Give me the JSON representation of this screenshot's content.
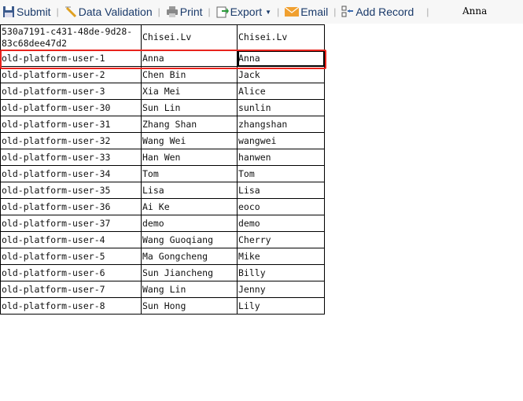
{
  "toolbar": {
    "submit": "Submit",
    "data_validation": "Data Validation",
    "print": "Print",
    "export": "Export",
    "email": "Email",
    "add_record": "Add Record",
    "user": "Anna"
  },
  "table": {
    "rows": [
      [
        "530a7191-c431-48de-9d28-83c68dee47d2",
        "Chisei.Lv",
        "Chisei.Lv"
      ],
      [
        "old-platform-user-1",
        "Anna",
        "Anna"
      ],
      [
        "old-platform-user-2",
        "Chen Bin",
        "Jack"
      ],
      [
        "old-platform-user-3",
        "Xia Mei",
        "Alice"
      ],
      [
        "old-platform-user-30",
        "Sun Lin",
        "sunlin"
      ],
      [
        "old-platform-user-31",
        "Zhang Shan",
        "zhangshan"
      ],
      [
        "old-platform-user-32",
        "Wang Wei",
        "wangwei"
      ],
      [
        "old-platform-user-33",
        "Han Wen",
        "hanwen"
      ],
      [
        "old-platform-user-34",
        "Tom",
        "Tom"
      ],
      [
        "old-platform-user-35",
        "Lisa",
        "Lisa"
      ],
      [
        "old-platform-user-36",
        "Ai Ke",
        "eoco"
      ],
      [
        "old-platform-user-37",
        "demo",
        "demo"
      ],
      [
        "old-platform-user-4",
        "Wang Guoqiang",
        "Cherry"
      ],
      [
        "old-platform-user-5",
        "Ma Gongcheng",
        "Mike"
      ],
      [
        "old-platform-user-6",
        "Sun Jiancheng",
        "Billy"
      ],
      [
        "old-platform-user-7",
        "Wang Lin",
        "Jenny"
      ],
      [
        "old-platform-user-8",
        "Sun Hong",
        "Lily"
      ]
    ]
  }
}
